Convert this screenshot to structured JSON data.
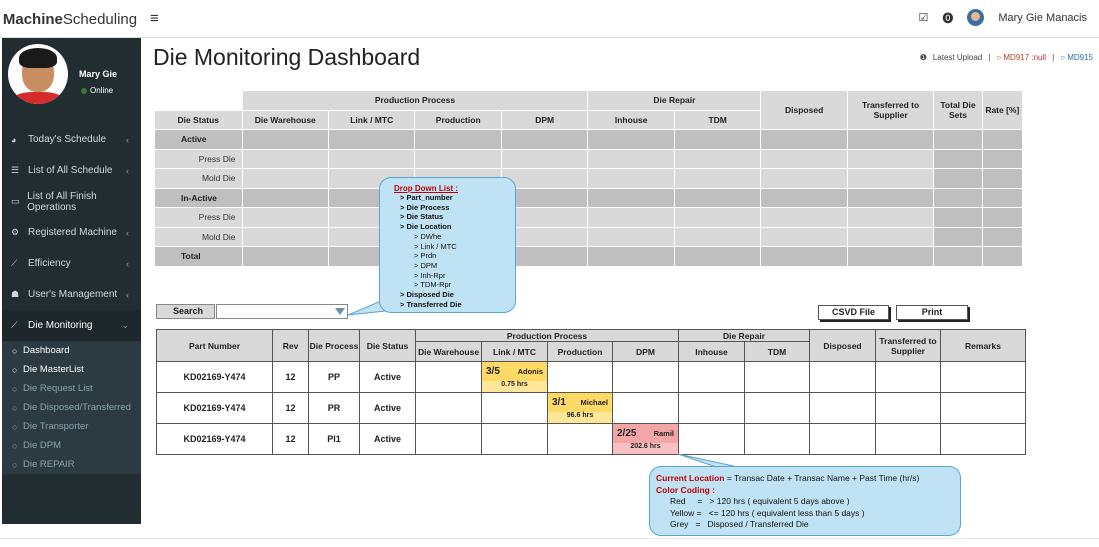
{
  "app": {
    "brand_bold": "Machine",
    "brand_rest": "Scheduling",
    "menu_icon": "hamburger-icon"
  },
  "topbar": {
    "user_name": "Mary Gie Manacis",
    "icons": [
      "checkbox-icon",
      "info-icon",
      "avatar"
    ]
  },
  "sidebar": {
    "user": {
      "name": "Mary Gie",
      "status": "Online"
    },
    "items": [
      {
        "icon": "dashboard-icon",
        "label": "Today's Schedule",
        "chevron": "‹"
      },
      {
        "icon": "list-icon",
        "label": "List of All Schedule",
        "chevron": "‹"
      },
      {
        "icon": "folder-icon",
        "label": "List of All Finish Operations",
        "chevron": ""
      },
      {
        "icon": "cogs-icon",
        "label": "Registered Machine",
        "chevron": "‹"
      },
      {
        "icon": "chart-icon",
        "label": "Efficiency",
        "chevron": "‹"
      },
      {
        "icon": "users-icon",
        "label": "User's Management",
        "chevron": "‹"
      },
      {
        "icon": "chart-icon",
        "label": "Die Monitoring",
        "chevron": "⌄"
      }
    ],
    "subitems": [
      "Dashboard",
      "Die MasterList",
      "Die Request List",
      "Die Disposed/Transferred",
      "Die Transporter",
      "Die DPM",
      "Die REPAIR"
    ]
  },
  "header": {
    "title": "Die Monitoring Dashboard",
    "latest_upload": "Latest Upload",
    "md917": "MD917 :null",
    "md915": "MD915"
  },
  "summary": {
    "group_production": "Production Process",
    "group_repair": "Die Repair",
    "disposed": "Disposed",
    "transferred": "Transferred to Supplier",
    "total_die_sets": "Total Die Sets",
    "rate": "Rate [%]",
    "die_status": "Die Status",
    "cols": [
      "Die Warehouse",
      "Link / MTC",
      "Production",
      "DPM",
      "Inhouse",
      "TDM"
    ],
    "active": "Active",
    "inactive": "In-Active",
    "press_die": "Press Die",
    "mold_die": "Mold Die",
    "total": "Total"
  },
  "search": {
    "label": "Search",
    "value": ""
  },
  "buttons": {
    "csv": "CSVD File",
    "print": "Print"
  },
  "list": {
    "headers": {
      "part_number": "Part Number",
      "rev": "Rev",
      "die_process": "Die Process",
      "die_status": "Die Status",
      "production": "Production Process",
      "repair": "Die Repair",
      "die_warehouse": "Die Warehouse",
      "link": "Link / MTC",
      "production_col": "Production",
      "dpm": "DPM",
      "inhouse": "Inhouse",
      "tdm": "TDM",
      "disposed": "Disposed",
      "transferred": "Transferred to Supplier",
      "remarks": "Remarks"
    },
    "rows": [
      {
        "part": "KD02169-Y474",
        "rev": "12",
        "process": "PP",
        "status": "Active",
        "tag_count": "3/5",
        "tag_name": "Adonis",
        "tag_hrs": "0.75 hrs"
      },
      {
        "part": "KD02169-Y474",
        "rev": "12",
        "process": "PR",
        "status": "Active",
        "tag_count": "3/1",
        "tag_name": "Michael",
        "tag_hrs": "96.6 hrs"
      },
      {
        "part": "KD02169-Y474",
        "rev": "12",
        "process": "PI1",
        "status": "Active",
        "tag_count": "2/25",
        "tag_name": "Ramil",
        "tag_hrs": "202.6 hrs"
      }
    ]
  },
  "callout_dropdown": {
    "heading": "Drop Down List :",
    "items": [
      "> Part_number",
      "> Die Process",
      "> Die Status",
      "> Die Location"
    ],
    "sub": [
      "> DWhe",
      "> Link / MTC",
      "> Prdn",
      "> DPM",
      "> Inh-Rpr",
      "> TDM-Rpr"
    ],
    "items2": [
      "> Disposed Die",
      "> Transferred Die"
    ]
  },
  "callout_legend": {
    "current_label": "Current Location",
    "current_text": " = Transac Date + Transac Name + Past Time (hr/s)",
    "color_label": "Color Coding :",
    "red": "Red     =   > 120 hrs ( equivalent 5 days above )",
    "yellow": "Yellow =   <= 120 hrs ( equivalent less than 5 days )",
    "grey": "Grey   =   Disposed / Transferred Die"
  }
}
